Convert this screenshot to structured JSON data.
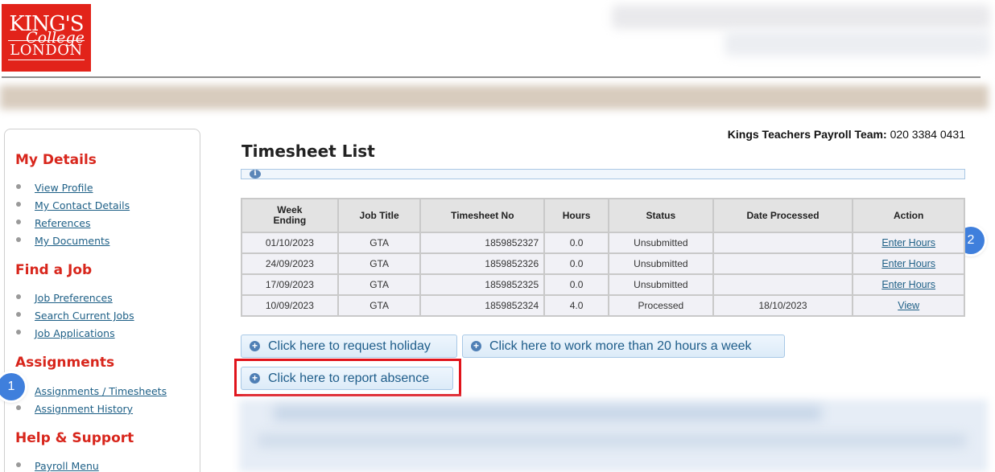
{
  "logo": {
    "line1": "KING'S",
    "line2": "College",
    "line3": "LONDON"
  },
  "sidebar": {
    "sections": [
      {
        "title": "My Details",
        "items": [
          "View Profile",
          "My Contact Details",
          "References",
          "My Documents"
        ]
      },
      {
        "title": "Find a Job",
        "items": [
          "Job Preferences",
          "Search Current Jobs",
          "Job Applications"
        ]
      },
      {
        "title": "Assignments",
        "items": [
          "Assignments / Timesheets",
          "Assignment History"
        ]
      },
      {
        "title": "Help & Support",
        "items": [
          "Payroll Menu"
        ]
      }
    ]
  },
  "contact": {
    "label": "Kings Teachers Payroll Team:",
    "phone": "020 3384 0431"
  },
  "page_title": "Timesheet List",
  "table": {
    "headers": [
      "Week Ending",
      "Job Title",
      "Timesheet No",
      "Hours",
      "Status",
      "Date Processed",
      "Action"
    ],
    "rows": [
      [
        "01/10/2023",
        "GTA",
        "1859852327",
        "0.0",
        "Unsubmitted",
        "",
        "Enter Hours"
      ],
      [
        "24/09/2023",
        "GTA",
        "1859852326",
        "0.0",
        "Unsubmitted",
        "",
        "Enter Hours"
      ],
      [
        "17/09/2023",
        "GTA",
        "1859852325",
        "0.0",
        "Unsubmitted",
        "",
        "Enter Hours"
      ],
      [
        "10/09/2023",
        "GTA",
        "1859852324",
        "4.0",
        "Processed",
        "18/10/2023",
        "View"
      ]
    ]
  },
  "buttons": {
    "holiday": "Click here to request holiday",
    "extra_hours": "Click here to work more than 20 hours a week",
    "absence": "Click here to report absence"
  },
  "callouts": {
    "one": "1",
    "two": "2"
  },
  "colors": {
    "brand_red": "#e2231a",
    "link": "#1d5f86",
    "highlight": "#e0131b",
    "callout": "#3f7fdc"
  }
}
